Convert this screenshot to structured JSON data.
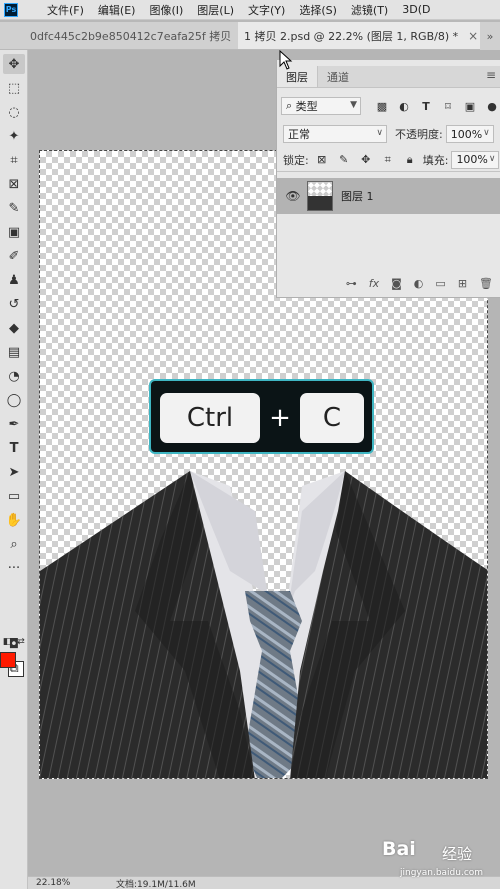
{
  "app": {
    "logo": "Ps"
  },
  "menu": [
    "文件(F)",
    "编辑(E)",
    "图像(I)",
    "图层(L)",
    "文字(Y)",
    "选择(S)",
    "滤镜(T)",
    "3D(D"
  ],
  "tabs": [
    {
      "label": "0dfc445c2b9e850412c7eafa25f 拷贝",
      "close": "×"
    },
    {
      "label": "1 拷贝 2.psd @ 22.2% (图层 1, RGB/8) *",
      "close": "×"
    }
  ],
  "tab_overflow": "»",
  "colors": {
    "foreground": "#ff1a00",
    "background": "#ffffff",
    "overlay_border": "#3fb6c3"
  },
  "shortcut": {
    "key1": "Ctrl",
    "plus": "+",
    "key2": "C"
  },
  "layers_panel": {
    "tabs": [
      "图层",
      "通道"
    ],
    "filter_type": "类型",
    "blend_mode": "正常",
    "opacity_label": "不透明度:",
    "opacity_value": "100%",
    "lock_label": "锁定:",
    "fill_label": "填充:",
    "fill_value": "100%",
    "layers": [
      {
        "name": "图层 1",
        "visible": true
      }
    ],
    "footer_icons": [
      "link-icon",
      "fx-icon",
      "mask-icon",
      "adjustment-icon",
      "folder-icon",
      "new-layer-icon",
      "trash-icon"
    ],
    "footer_fx": "fx"
  },
  "status": {
    "zoom": "22.18%",
    "doc": "文档:19.1M/11.6M"
  },
  "watermark": {
    "logo": "Bai",
    "text": "经验",
    "url": "jingyan.baidu.com"
  }
}
